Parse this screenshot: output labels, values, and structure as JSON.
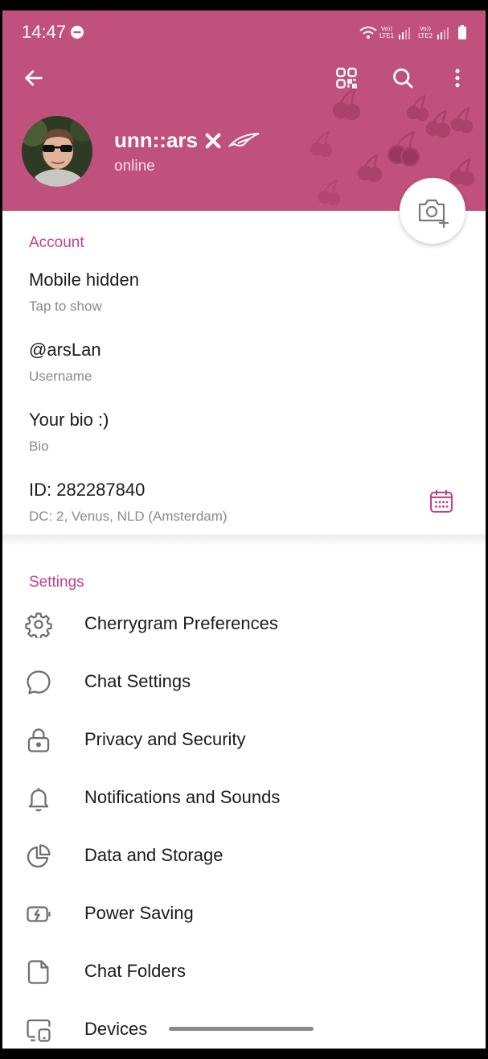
{
  "status_bar": {
    "time": "14:47",
    "sim1": "LTE1",
    "sim2": "LTE2"
  },
  "toolbar": {
    "back_icon": "arrow-left-icon",
    "qr_icon": "qr-code-icon",
    "search_icon": "search-icon",
    "more_icon": "more-vertical-icon"
  },
  "profile": {
    "name": "unn::ars",
    "status": "online",
    "accent_color": "#c0517c"
  },
  "account": {
    "title": "Account",
    "phone": {
      "value": "Mobile hidden",
      "label": "Tap to show"
    },
    "username": {
      "value": "@arsLan",
      "label": "Username"
    },
    "bio": {
      "value": "Your bio :)",
      "label": "Bio"
    },
    "id": {
      "value": "ID: 282287840",
      "label": "DC: 2, Venus, NLD (Amsterdam)"
    }
  },
  "settings": {
    "title": "Settings",
    "items": [
      {
        "label": "Cherrygram Preferences",
        "icon": "gear-icon"
      },
      {
        "label": "Chat Settings",
        "icon": "chat-bubble-icon"
      },
      {
        "label": "Privacy and Security",
        "icon": "lock-icon"
      },
      {
        "label": "Notifications and Sounds",
        "icon": "bell-icon"
      },
      {
        "label": "Data and Storage",
        "icon": "pie-chart-icon"
      },
      {
        "label": "Power Saving",
        "icon": "battery-icon"
      },
      {
        "label": "Chat Folders",
        "icon": "folder-icon"
      },
      {
        "label": "Devices",
        "icon": "devices-icon"
      }
    ]
  },
  "colors": {
    "accent": "#c33f8e",
    "header": "#c0517c"
  }
}
